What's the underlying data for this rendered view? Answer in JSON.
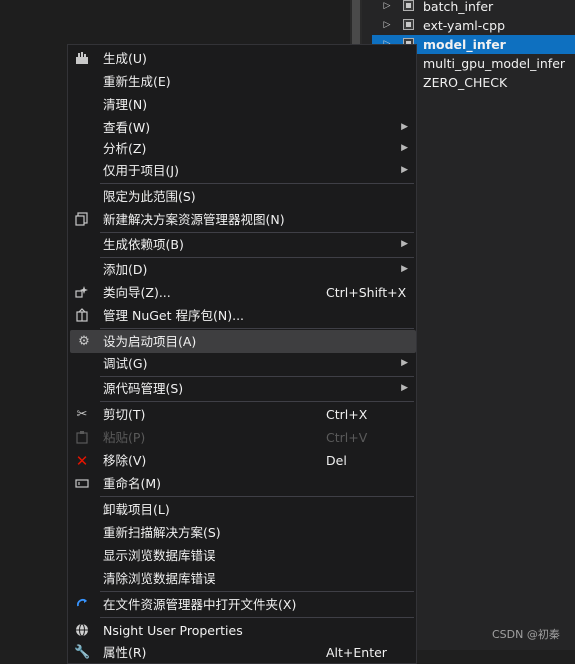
{
  "solution_explorer": {
    "items": [
      {
        "label": "batch_infer",
        "expander": "▷"
      },
      {
        "label": "ext-yaml-cpp",
        "expander": "▷"
      },
      {
        "label": "model_infer",
        "expander": "▷"
      },
      {
        "label": "multi_gpu_model_infer",
        "expander": ""
      },
      {
        "label": "ZERO_CHECK",
        "expander": ""
      }
    ]
  },
  "context_menu": {
    "items": [
      {
        "label": "生成(U)",
        "icon": "build-icon"
      },
      {
        "label": "重新生成(E)"
      },
      {
        "label": "清理(N)"
      },
      {
        "label": "查看(W)",
        "submenu": true
      },
      {
        "label": "分析(Z)",
        "submenu": true
      },
      {
        "label": "仅用于项目(J)",
        "submenu": true
      },
      {
        "label": "限定为此范围(S)"
      },
      {
        "label": "新建解决方案资源管理器视图(N)",
        "icon": "new-view-icon"
      },
      {
        "label": "生成依赖项(B)",
        "submenu": true
      },
      {
        "label": "添加(D)",
        "submenu": true
      },
      {
        "label": "类向导(Z)...",
        "icon": "class-wizard-icon",
        "shortcut": "Ctrl+Shift+X"
      },
      {
        "label": "管理 NuGet 程序包(N)...",
        "icon": "nuget-package-icon"
      },
      {
        "label": "设为启动项目(A)",
        "icon": "gear-icon"
      },
      {
        "label": "调试(G)",
        "submenu": true
      },
      {
        "label": "源代码管理(S)",
        "submenu": true
      },
      {
        "label": "剪切(T)",
        "icon": "scissors-icon",
        "shortcut": "Ctrl+X"
      },
      {
        "label": "粘贴(P)",
        "icon": "paste-icon",
        "shortcut": "Ctrl+V"
      },
      {
        "label": "移除(V)",
        "icon": "remove-icon",
        "shortcut": "Del"
      },
      {
        "label": "重命名(M)",
        "icon": "rename-icon"
      },
      {
        "label": "卸载项目(L)"
      },
      {
        "label": "重新扫描解决方案(S)"
      },
      {
        "label": "显示浏览数据库错误"
      },
      {
        "label": "清除浏览数据库错误"
      },
      {
        "label": "在文件资源管理器中打开文件夹(X)",
        "icon": "refresh-arrow-icon"
      },
      {
        "label": "Nsight User Properties",
        "icon": "globe-icon"
      },
      {
        "label": "属性(R)",
        "shortcut": "Alt+Enter"
      }
    ]
  },
  "watermark": "CSDN @初秦",
  "colors": {
    "selection": "#0e70c0",
    "menu_bg": "#1b1b1c",
    "hover_bg": "#3e3e40",
    "remove_icon": "#e51400",
    "refresh_icon": "#3794ff"
  }
}
